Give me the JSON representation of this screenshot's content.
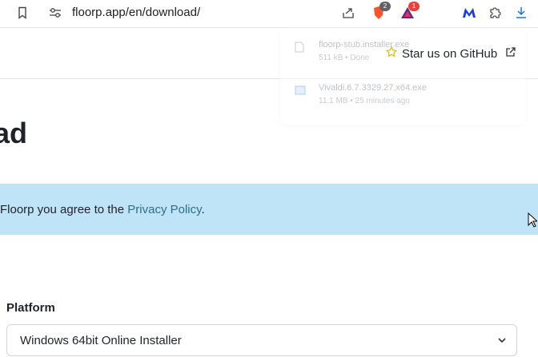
{
  "browser": {
    "url": "floorp.app/en/download/",
    "extensions": {
      "brave_badge": "2",
      "alert_badge": "1"
    }
  },
  "header": {
    "github_link": "Star us on GitHub"
  },
  "downloads": [
    {
      "name": "floorp-stub.installer.exe",
      "meta": "511 kB • Done"
    },
    {
      "name": "Vivaldi.6.7.3329.27.x64.exe",
      "meta": "11.1 MB • 25 minutes ago"
    }
  ],
  "main": {
    "heading": "ad",
    "notice_prefix": "Floorp you agree to the ",
    "notice_link": "Privacy Policy",
    "notice_suffix": "."
  },
  "platform": {
    "label": "Platform",
    "selected": "Windows 64bit Online Installer"
  },
  "colors": {
    "notice_bg": "#bfe3f7",
    "link": "#2f6f86",
    "brave": "#fb542b",
    "malwarebytes": "#1a3ee6"
  }
}
